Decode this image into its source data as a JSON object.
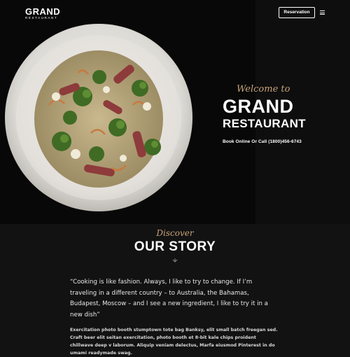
{
  "header": {
    "logo_main": "GRAND",
    "logo_sub": "RESTAURANT",
    "reservation_label": "Reservation",
    "menu_icon": "hamburger-menu-icon"
  },
  "hero": {
    "welcome": "Welcome to",
    "title_line1": "GRAND",
    "title_line2": "RESTAURANT",
    "booking_text": "Book Online Or Call (1800)456-6743"
  },
  "story": {
    "kicker": "Discover",
    "title": "OUR STORY",
    "chevron_icon": "chevron-down-icon",
    "quote": "“Cooking is like fashion. Always, I like to try to change. If I’m traveling in a different country – to Australia, the Bahamas, Budapest, Moscow – and I see a new ingredient, I like to try it in a new dish”",
    "body": "Exercitation photo booth stumptown tote bag Banksy, elit small batch freegan sed. Craft beer elit seitan exercitation, photo booth et 8-bit kale chips proident chillwave deep v laborum. Aliquip veniam delectus, Marfa eiusmod Pinterest in do umami readymade swag."
  },
  "colors": {
    "background": "#121212",
    "accent": "#c8a37a",
    "text": "#ffffff"
  }
}
